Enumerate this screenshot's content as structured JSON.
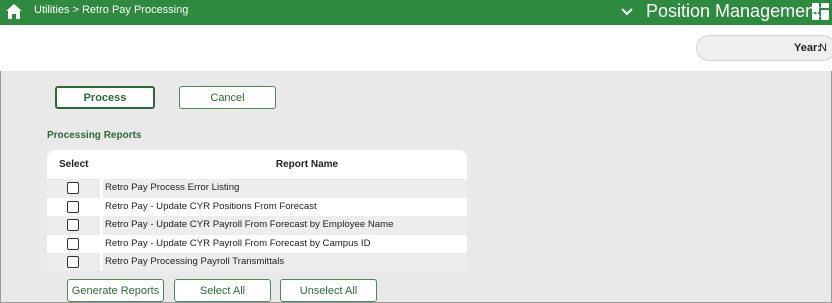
{
  "topbar": {
    "breadcrumb": "Utilities > Retro Pay Processing",
    "app_title": "Position Management"
  },
  "header": {
    "year_label": "Year:",
    "year_value": "N"
  },
  "actions": {
    "process_label": "Process",
    "cancel_label": "Cancel"
  },
  "reports": {
    "section_title": "Processing Reports",
    "col_select": "Select",
    "col_name": "Report Name",
    "rows": [
      {
        "name": "Retro Pay Process Error Listing",
        "checked": false
      },
      {
        "name": "Retro Pay - Update CYR Positions From Forecast",
        "checked": false
      },
      {
        "name": "Retro Pay - Update CYR Payroll From Forecast by Employee Name",
        "checked": false
      },
      {
        "name": "Retro Pay - Update CYR Payroll From Forecast by Campus ID",
        "checked": false
      },
      {
        "name": "Retro Pay Processing Payroll Transmittals",
        "checked": false
      }
    ]
  },
  "footer": {
    "generate_label": "Generate Reports",
    "select_all_label": "Select All",
    "unselect_all_label": "Unselect All"
  },
  "colors": {
    "topbar": "#2d8a3e",
    "accent": "#2d6a36",
    "background": "#e9e9e9"
  },
  "icons": [
    "home-icon",
    "chevron-down-icon",
    "dashboard-grid-icon"
  ]
}
